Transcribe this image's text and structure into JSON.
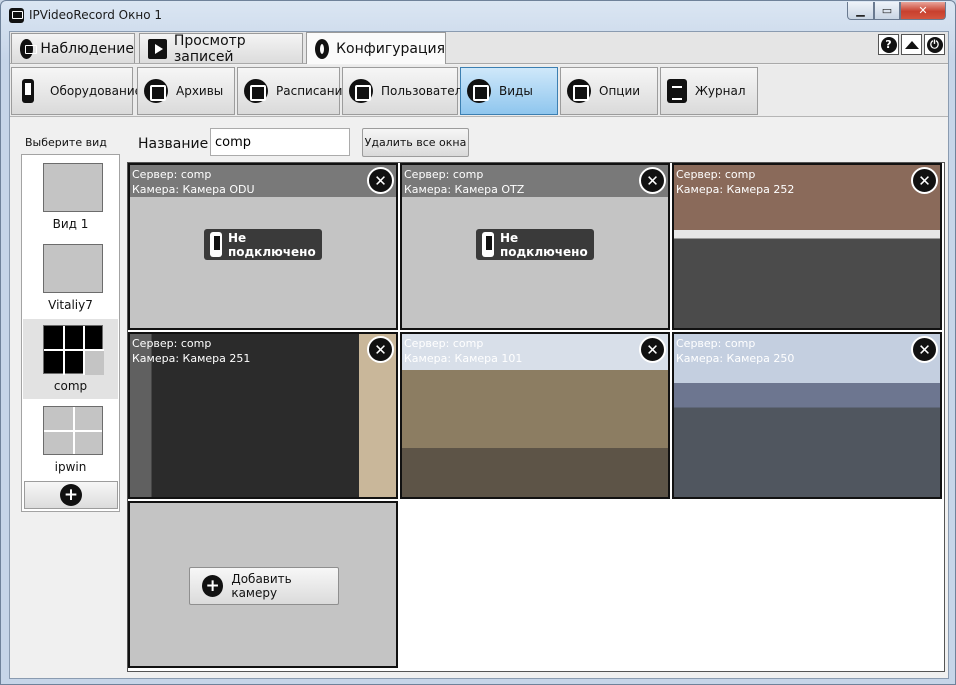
{
  "window": {
    "title": "IPVideoRecord Окно 1"
  },
  "tabs": [
    {
      "label": "Наблюдение",
      "icon": "monitor-icon"
    },
    {
      "label": "Просмотр записей",
      "icon": "film-icon"
    },
    {
      "label": "Конфигурация",
      "icon": "gear-icon",
      "active": true
    }
  ],
  "topright": {
    "help": "?",
    "power": "⏻"
  },
  "subtabs": [
    {
      "label": "Оборудование",
      "icon": "device-icon"
    },
    {
      "label": "Архивы",
      "icon": "archive-icon"
    },
    {
      "label": "Расписания",
      "icon": "clock-icon"
    },
    {
      "label": "Пользователи",
      "icon": "user-icon"
    },
    {
      "label": "Виды",
      "icon": "grid-icon",
      "active": true
    },
    {
      "label": "Опции",
      "icon": "tools-icon"
    },
    {
      "label": "Журнал",
      "icon": "journal-icon"
    }
  ],
  "views": {
    "title": "Выберите вид",
    "items": [
      {
        "label": "Вид 1"
      },
      {
        "label": "Vitaliy7"
      },
      {
        "label": "comp",
        "selected": true
      },
      {
        "label": "ipwin"
      }
    ],
    "add": "+"
  },
  "editor": {
    "name_label": "Название",
    "name_value": "comp",
    "delete_all": "Удалить все окна"
  },
  "cells": [
    {
      "server": "Сервер: comp",
      "camera": "Камера: Камера ODU",
      "status": "Не подключено",
      "close": "✕"
    },
    {
      "server": "Сервер: comp",
      "camera": "Камера: Камера OTZ",
      "status": "Не подключено",
      "close": "✕"
    },
    {
      "server": "Сервер: comp",
      "camera": "Камера: Камера 252",
      "close": "✕"
    },
    {
      "server": "Сервер: comp",
      "camera": "Камера: Камера 251",
      "close": "✕"
    },
    {
      "server": "Сервер: comp",
      "camera": "Камера: Камера 101",
      "close": "✕"
    },
    {
      "server": "Сервер: comp",
      "camera": "Камера: Камера 250",
      "close": "✕"
    }
  ],
  "add_camera": {
    "label": "Добавить камеру",
    "plus": "+"
  }
}
